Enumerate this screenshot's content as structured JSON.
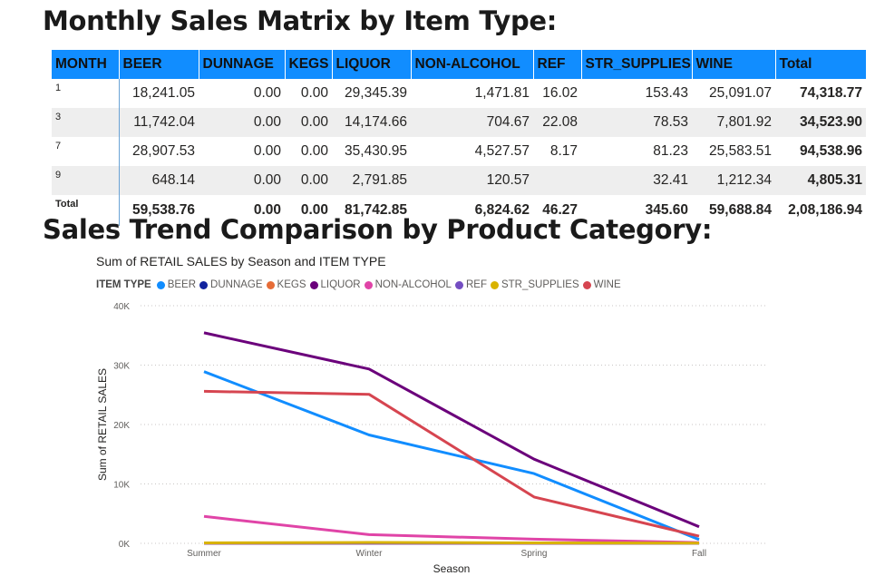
{
  "heading_matrix": "Monthly Sales Matrix by Item Type:",
  "heading_chart": "Sales Trend Comparison by Product Category:",
  "matrix": {
    "header_color": "#118dff",
    "columns": [
      "MONTH",
      "BEER",
      "DUNNAGE",
      "KEGS",
      "LIQUOR",
      "NON-ALCOHOL",
      "REF",
      "STR_SUPPLIES",
      "WINE",
      "Total"
    ],
    "rows": [
      {
        "label": "1",
        "cells": [
          "18,241.05",
          "0.00",
          "0.00",
          "29,345.39",
          "1,471.81",
          "16.02",
          "153.43",
          "25,091.07",
          "74,318.77"
        ]
      },
      {
        "label": "3",
        "cells": [
          "11,742.04",
          "0.00",
          "0.00",
          "14,174.66",
          "704.67",
          "22.08",
          "78.53",
          "7,801.92",
          "34,523.90"
        ]
      },
      {
        "label": "7",
        "cells": [
          "28,907.53",
          "0.00",
          "0.00",
          "35,430.95",
          "4,527.57",
          "8.17",
          "81.23",
          "25,583.51",
          "94,538.96"
        ]
      },
      {
        "label": "9",
        "cells": [
          "648.14",
          "0.00",
          "0.00",
          "2,791.85",
          "120.57",
          "",
          "32.41",
          "1,212.34",
          "4,805.31"
        ]
      }
    ],
    "total_row": {
      "label": "Total",
      "cells": [
        "59,538.76",
        "0.00",
        "0.00",
        "81,742.85",
        "6,824.62",
        "46.27",
        "345.60",
        "59,688.84",
        "2,08,186.94"
      ]
    }
  },
  "chart_data": {
    "type": "line",
    "title": "Sum of RETAIL SALES by Season and ITEM TYPE",
    "legend_title": "ITEM TYPE",
    "legend_position": "top-left",
    "xlabel": "Season",
    "ylabel": "Sum of RETAIL SALES",
    "categories": [
      "Summer",
      "Winter",
      "Spring",
      "Fall"
    ],
    "ylim": [
      0,
      40000
    ],
    "yticks": [
      {
        "v": 0,
        "label": "0K"
      },
      {
        "v": 10000,
        "label": "10K"
      },
      {
        "v": 20000,
        "label": "20K"
      },
      {
        "v": 30000,
        "label": "30K"
      },
      {
        "v": 40000,
        "label": "40K"
      }
    ],
    "grid": true,
    "series": [
      {
        "name": "BEER",
        "color": "#118dff",
        "values": [
          28907.53,
          18241.05,
          11742.04,
          648.14
        ]
      },
      {
        "name": "DUNNAGE",
        "color": "#12239e",
        "values": [
          0,
          0,
          0,
          0
        ]
      },
      {
        "name": "KEGS",
        "color": "#e66c37",
        "values": [
          0,
          0,
          0,
          0
        ]
      },
      {
        "name": "LIQUOR",
        "color": "#6b007b",
        "values": [
          35430.95,
          29345.39,
          14174.66,
          2791.85
        ]
      },
      {
        "name": "NON-ALCOHOL",
        "color": "#e044a7",
        "values": [
          4527.57,
          1471.81,
          704.67,
          120.57
        ]
      },
      {
        "name": "REF",
        "color": "#744ec2",
        "values": [
          8.17,
          16.02,
          22.08,
          0
        ]
      },
      {
        "name": "STR_SUPPLIES",
        "color": "#d9b300",
        "values": [
          81.23,
          153.43,
          78.53,
          32.41
        ]
      },
      {
        "name": "WINE",
        "color": "#d64550",
        "values": [
          25583.51,
          25091.07,
          7801.92,
          1212.34
        ]
      }
    ]
  }
}
